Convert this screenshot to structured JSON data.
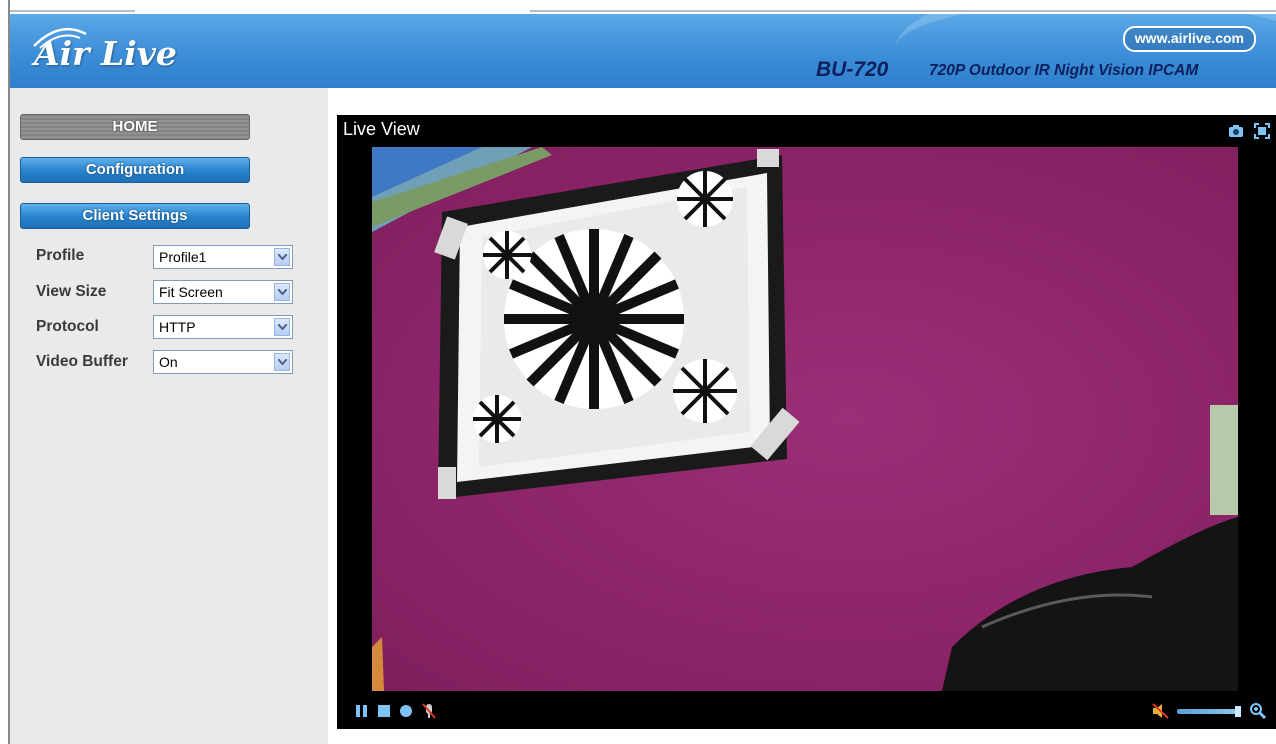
{
  "header": {
    "logo_text": "Air Live",
    "url": "www.airlive.com",
    "model": "BU-720",
    "product": "720P Outdoor IR Night Vision IPCAM"
  },
  "nav": {
    "home": "HOME",
    "configuration": "Configuration",
    "client_settings": "Client Settings"
  },
  "settings": [
    {
      "label": "Profile",
      "value": "Profile1"
    },
    {
      "label": "View Size",
      "value": "Fit Screen"
    },
    {
      "label": "Protocol",
      "value": "HTTP"
    },
    {
      "label": "Video Buffer",
      "value": "On"
    }
  ],
  "liveview": {
    "title": "Live View",
    "icons": [
      "snapshot-camera-icon",
      "fullscreen-icon"
    ],
    "controls": [
      "pause-icon",
      "stop-icon",
      "record-icon",
      "microphone-muted-icon",
      "speaker-muted-icon",
      "zoom-icon"
    ]
  },
  "colors": {
    "header_blue": "#3c8ed8",
    "button_blue": "#2b86cf",
    "video_bg": "#8c2468"
  }
}
